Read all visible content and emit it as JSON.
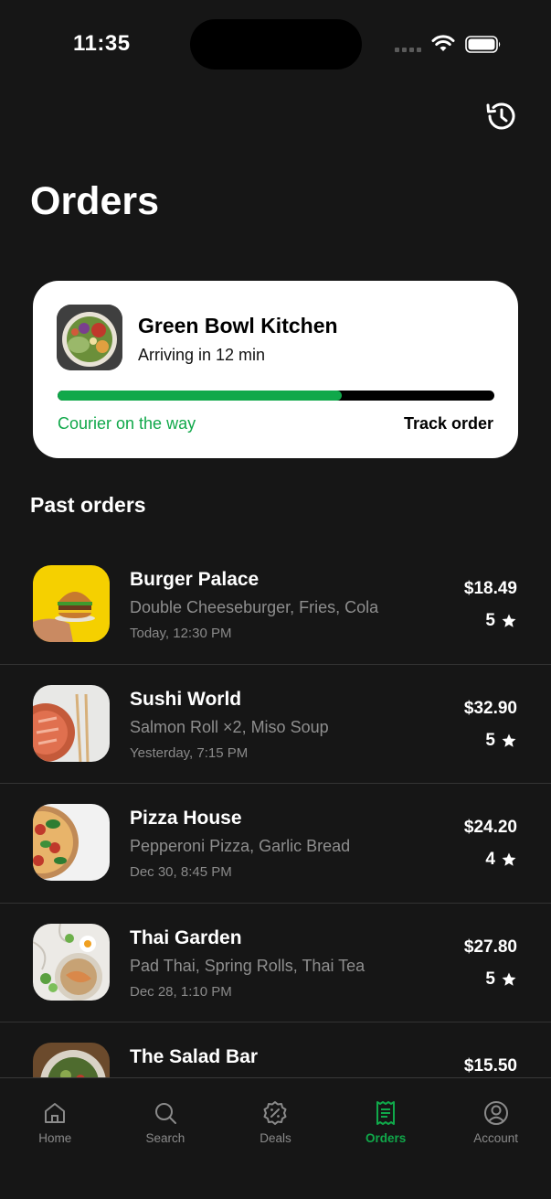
{
  "status_bar": {
    "time": "11:35"
  },
  "page": {
    "title": "Orders"
  },
  "active_order": {
    "restaurant": "Green Bowl Kitchen",
    "eta": "Arriving in 12 min",
    "progress": 0.65,
    "status": "Courier on the way",
    "action": "Track order"
  },
  "past_orders": {
    "title": "Past orders",
    "items": [
      {
        "name": "Burger Palace",
        "items": "Double Cheeseburger, Fries, Cola",
        "date": "Today, 12:30 PM",
        "price": "$18.49",
        "rating": "5"
      },
      {
        "name": "Sushi World",
        "items": "Salmon Roll ×2, Miso Soup",
        "date": "Yesterday, 7:15 PM",
        "price": "$32.90",
        "rating": "5"
      },
      {
        "name": "Pizza House",
        "items": "Pepperoni Pizza, Garlic Bread",
        "date": "Dec 30, 8:45 PM",
        "price": "$24.20",
        "rating": "4"
      },
      {
        "name": "Thai Garden",
        "items": "Pad Thai, Spring Rolls, Thai Tea",
        "date": "Dec 28, 1:10 PM",
        "price": "$27.80",
        "rating": "5"
      },
      {
        "name": "The Salad Bar",
        "items": "",
        "date": "",
        "price": "$15.50",
        "rating": ""
      }
    ]
  },
  "tabbar": {
    "home": "Home",
    "search": "Search",
    "deals": "Deals",
    "orders": "Orders",
    "account": "Account"
  },
  "colors": {
    "accent": "#10a84a",
    "background": "#161616"
  }
}
